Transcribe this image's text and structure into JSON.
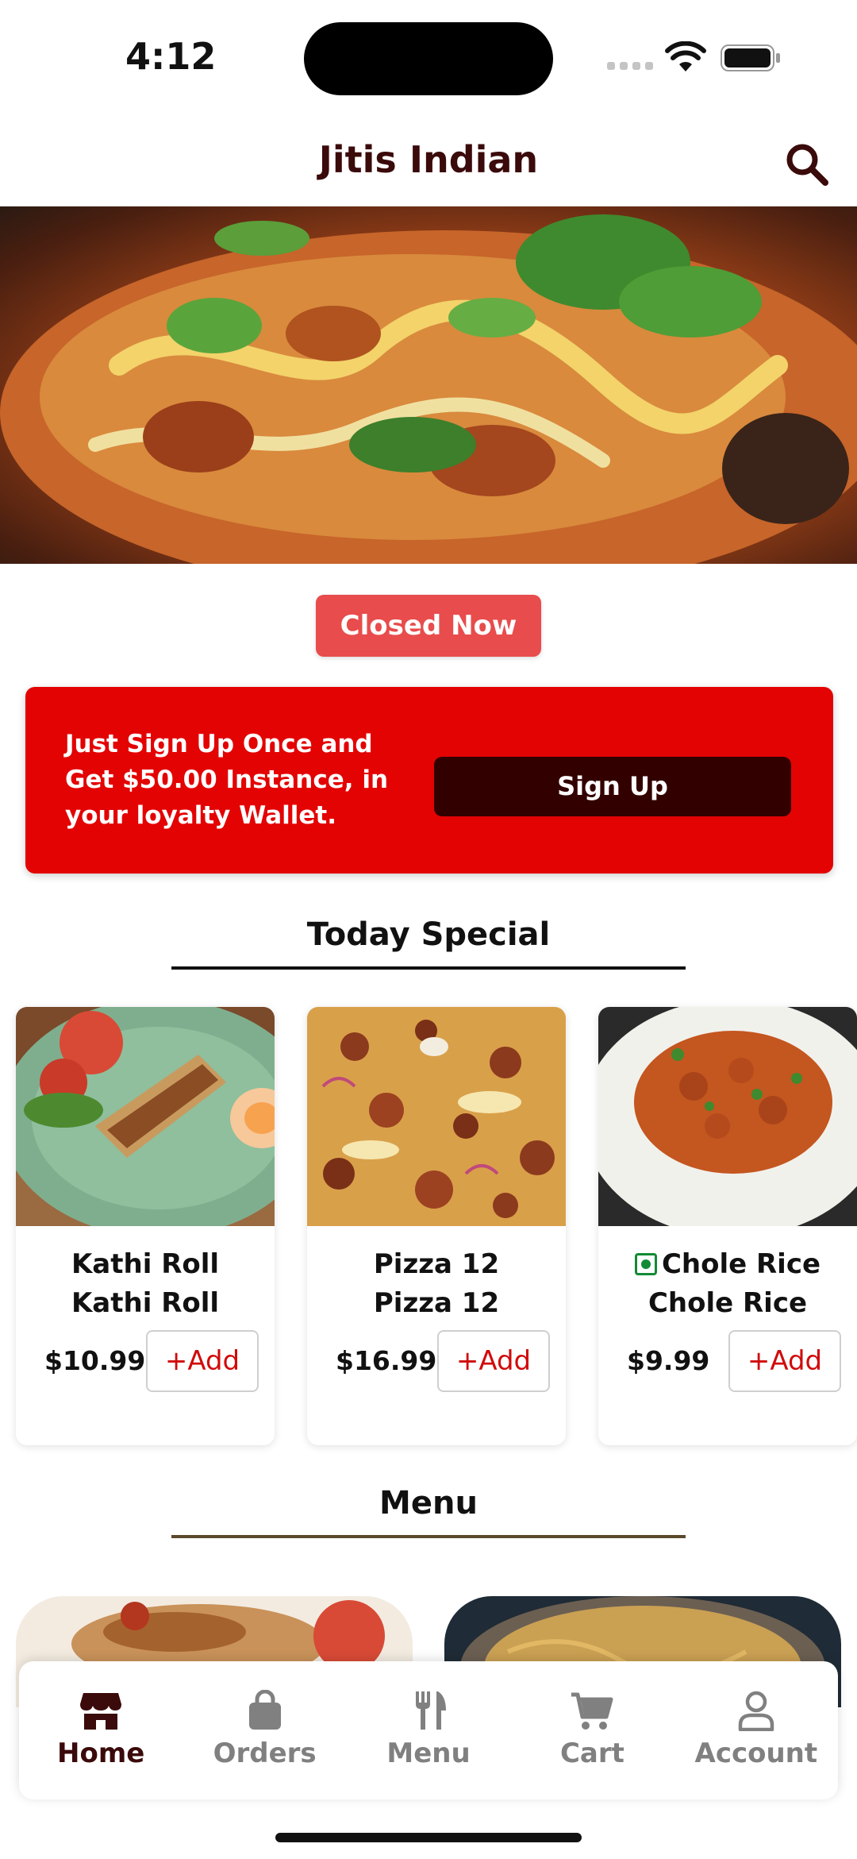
{
  "status_bar": {
    "time": "4:12"
  },
  "header": {
    "title": "Jitis Indian",
    "search_icon": "search-icon"
  },
  "store_status": {
    "label": "Closed Now",
    "color": "#e84c4c"
  },
  "promo": {
    "text": "Just Sign Up Once and Get $50.00 Instance, in your loyalty Wallet.",
    "button_label": "Sign Up",
    "background": "#e30303",
    "button_color": "#330000"
  },
  "today_special": {
    "title": "Today Special",
    "items": [
      {
        "name": "Kathi Roll",
        "subtitle": "Kathi Roll",
        "price": "$10.99",
        "add_label": "+Add",
        "veg": false
      },
      {
        "name": "Pizza 12",
        "subtitle": "Pizza 12",
        "price": "$16.99",
        "add_label": "+Add",
        "veg": false
      },
      {
        "name": "Chole Rice",
        "subtitle": "Chole Rice",
        "price": "$9.99",
        "add_label": "+Add",
        "veg": true
      }
    ]
  },
  "menu_section": {
    "title": "Menu"
  },
  "bottom_nav": {
    "items": [
      {
        "label": "Home",
        "icon": "store-icon",
        "active": true
      },
      {
        "label": "Orders",
        "icon": "bag-icon",
        "active": false
      },
      {
        "label": "Menu",
        "icon": "fork-knife-icon",
        "active": false
      },
      {
        "label": "Cart",
        "icon": "cart-icon",
        "active": false
      },
      {
        "label": "Account",
        "icon": "user-icon",
        "active": false
      }
    ]
  },
  "colors": {
    "brand_dark": "#3b0a0a",
    "accent_red": "#d10a0a",
    "veg_green": "#138a36"
  }
}
